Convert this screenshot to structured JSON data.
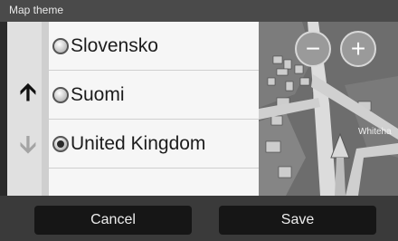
{
  "header": {
    "title": "Map theme"
  },
  "scroll": {
    "up_icon": "arrow-up-icon",
    "down_icon": "arrow-down-icon"
  },
  "list": {
    "items": [
      {
        "label": "Slovensko",
        "selected": false
      },
      {
        "label": "Suomi",
        "selected": false
      },
      {
        "label": "United Kingdom",
        "selected": true
      },
      {
        "label": "",
        "selected": false
      }
    ]
  },
  "map": {
    "zoom_out_label": "−",
    "zoom_in_label": "+",
    "street_label": "Whiteha"
  },
  "footer": {
    "cancel_label": "Cancel",
    "save_label": "Save"
  },
  "colors": {
    "list_bg": "#f6f6f6",
    "bottom_bar": "#3a3a3a",
    "button_bg": "#161616"
  }
}
